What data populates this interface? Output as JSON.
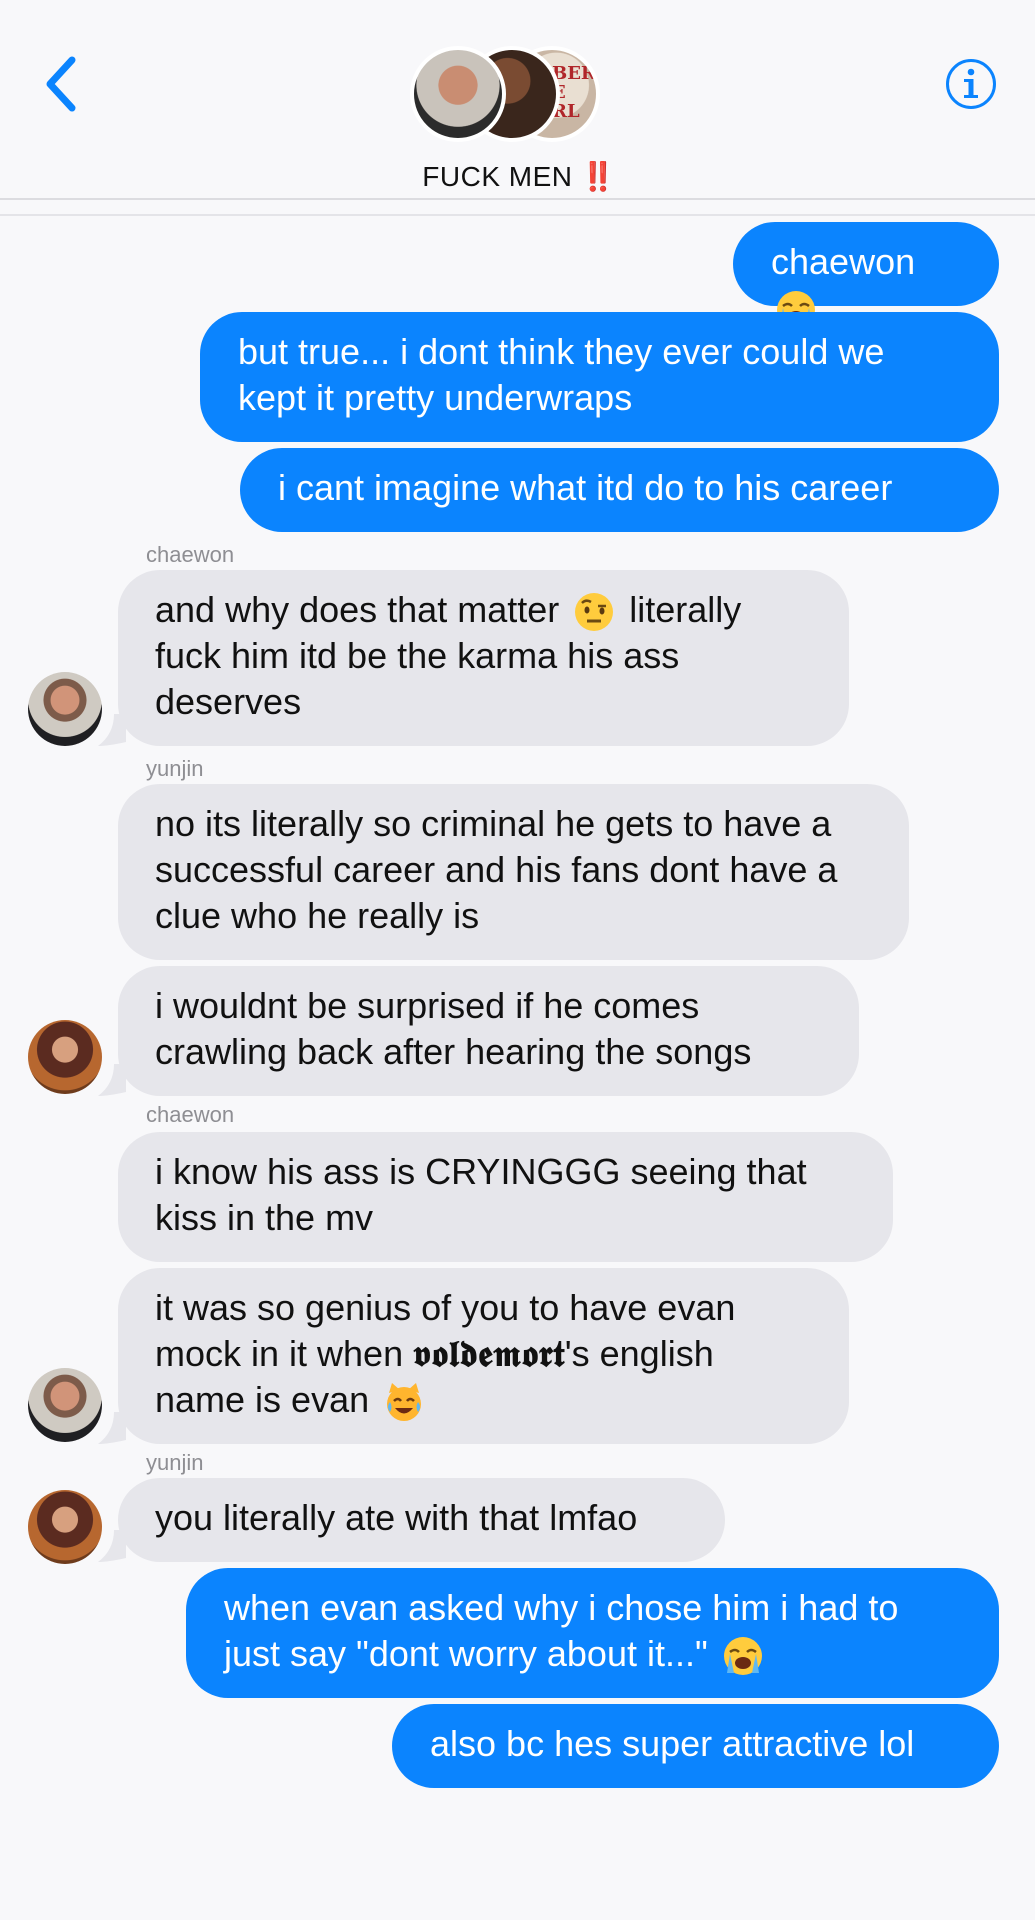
{
  "header": {
    "title": "FUCK MEN",
    "title_emoji": "‼️",
    "back_icon": "chevron-left-icon",
    "info_icon": "info-icon",
    "avatar_shirt_text": "BER\nE\nRL",
    "accent_color": "#0b84fe"
  },
  "messages": [
    {
      "type": "sent",
      "text": "chaewon",
      "emoji": "loudly-crying-face"
    },
    {
      "type": "sent",
      "text": "but true... i dont think they ever could we kept it pretty underwraps"
    },
    {
      "type": "sent",
      "text": "i cant imagine what itd do to his career"
    },
    {
      "type": "received",
      "sender": "chaewon",
      "text_a": "and why does that matter",
      "text_b": "literally fuck him itd be the karma his ass deserves",
      "emoji": "face-with-raised-eyebrow"
    },
    {
      "type": "received",
      "sender": "yunjin",
      "text": "no its literally so criminal he gets to have a successful career and his fans dont have a clue who he really is"
    },
    {
      "type": "received",
      "sender": "yunjin",
      "text": "i wouldnt be surprised if he comes crawling back after hearing the songs"
    },
    {
      "type": "received",
      "sender": "chaewon",
      "text": "i know his ass is CRYINGGG seeing that kiss in the mv"
    },
    {
      "type": "received",
      "sender": "chaewon",
      "text_a": "it was so genius of you to have evan mock in it when",
      "text_styled": "𝖛𝖔𝖑𝖉𝖊𝖒𝖔𝖗𝖙",
      "text_b": "'s english name is evan",
      "emoji": "cat-face-with-tears-of-joy"
    },
    {
      "type": "received",
      "sender": "yunjin",
      "text": "you literally ate with that lmfao"
    },
    {
      "type": "sent",
      "text": "when evan asked why i chose him i had to just say \"dont worry about it...\"",
      "emoji": "loudly-crying-face"
    },
    {
      "type": "sent",
      "text": "also bc hes super attractive lol"
    }
  ],
  "names": {
    "chaewon": "chaewon",
    "yunjin": "yunjin"
  },
  "colors": {
    "sent_bubble": "#0b84fe",
    "received_bubble": "#e6e6eb",
    "sender_name": "#8e8e93",
    "background": "#f8f8fa"
  }
}
